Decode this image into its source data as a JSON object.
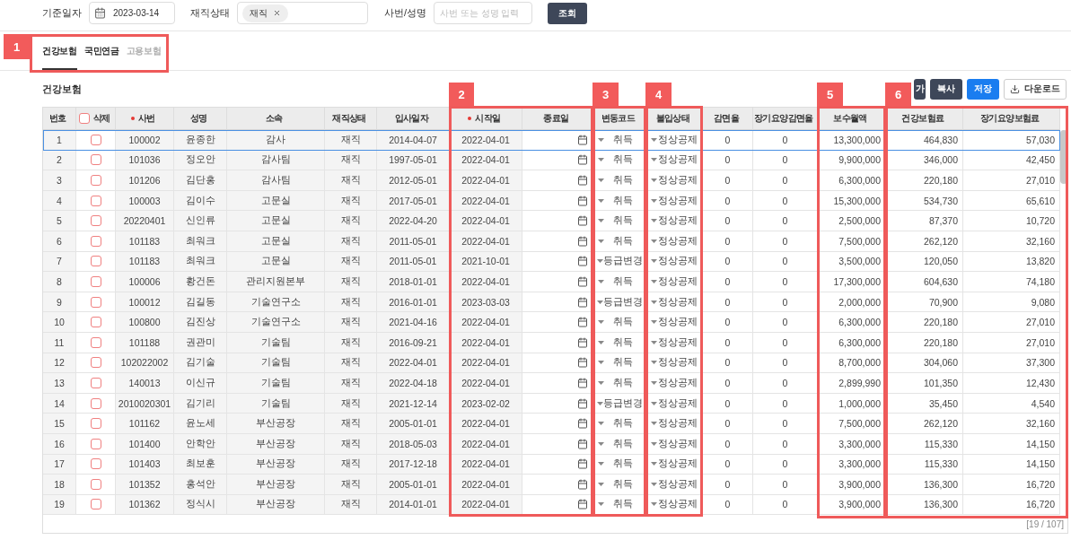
{
  "filters": {
    "date_label": "기준일자",
    "date_value": "2023-03-14",
    "status_label": "재직상태",
    "status_chips": [
      "재직"
    ],
    "search_label": "사번/성명",
    "search_placeholder": "사번 또는 성명 입력",
    "search_button": "조회"
  },
  "tabs": [
    {
      "label": "건강보험",
      "selected": true,
      "disabled": false
    },
    {
      "label": "국민연금",
      "selected": false,
      "disabled": false
    },
    {
      "label": "고용보험",
      "selected": false,
      "disabled": true
    }
  ],
  "section_title": "건강보험",
  "actions": [
    {
      "label": "가",
      "kind": "dark"
    },
    {
      "label": "복사",
      "kind": "dark"
    },
    {
      "label": "저장",
      "kind": "primary"
    },
    {
      "label": "다운로드",
      "kind": "download"
    }
  ],
  "table": {
    "columns": [
      {
        "label": "번호",
        "kind": "readonly",
        "required": false
      },
      {
        "label": "삭제",
        "kind": "check",
        "required": false,
        "checked": false
      },
      {
        "label": "사번",
        "kind": "readonly",
        "required": true
      },
      {
        "label": "성명",
        "kind": "readonly",
        "required": false
      },
      {
        "label": "소속",
        "kind": "readonly",
        "required": false
      },
      {
        "label": "재직상태",
        "kind": "readonly",
        "required": false
      },
      {
        "label": "입사일자",
        "kind": "readonly",
        "required": false
      },
      {
        "label": "시작일",
        "kind": "readonly",
        "required": true
      },
      {
        "label": "종료일",
        "kind": "picker",
        "required": false
      },
      {
        "label": "변동코드",
        "kind": "select",
        "required": false
      },
      {
        "label": "불입상태",
        "kind": "select",
        "required": false
      },
      {
        "label": "감면율",
        "kind": "input",
        "required": false
      },
      {
        "label": "장기요양감면율",
        "kind": "input",
        "required": false
      },
      {
        "label": "보수월액",
        "kind": "amount",
        "required": false
      },
      {
        "label": "건강보험료",
        "kind": "amount",
        "required": false
      },
      {
        "label": "장기요양보험료",
        "kind": "amount",
        "required": false
      }
    ],
    "rows": [
      {
        "selected": true,
        "checked": false,
        "cells": [
          "1",
          "",
          "100002",
          "윤종한",
          "감사",
          "재직",
          "2014-04-07",
          "2022-04-01",
          "",
          "취득",
          "정상공제",
          "0",
          "0",
          "13,300,000",
          "464,830",
          "57,030"
        ]
      },
      {
        "selected": false,
        "checked": false,
        "cells": [
          "2",
          "",
          "101036",
          "정오안",
          "감사팀",
          "재직",
          "1997-05-01",
          "2022-04-01",
          "",
          "취득",
          "정상공제",
          "0",
          "0",
          "9,900,000",
          "346,000",
          "42,450"
        ]
      },
      {
        "selected": false,
        "checked": false,
        "cells": [
          "3",
          "",
          "101206",
          "김단홍",
          "감사팀",
          "재직",
          "2012-05-01",
          "2022-04-01",
          "",
          "취득",
          "정상공제",
          "0",
          "0",
          "6,300,000",
          "220,180",
          "27,010"
        ]
      },
      {
        "selected": false,
        "checked": false,
        "cells": [
          "4",
          "",
          "100003",
          "김이수",
          "고문실",
          "재직",
          "2017-05-01",
          "2022-04-01",
          "",
          "취득",
          "정상공제",
          "0",
          "0",
          "15,300,000",
          "534,730",
          "65,610"
        ]
      },
      {
        "selected": false,
        "checked": false,
        "cells": [
          "5",
          "",
          "20220401",
          "신인류",
          "고문실",
          "재직",
          "2022-04-20",
          "2022-04-01",
          "",
          "취득",
          "정상공제",
          "0",
          "0",
          "2,500,000",
          "87,370",
          "10,720"
        ]
      },
      {
        "selected": false,
        "checked": false,
        "cells": [
          "6",
          "",
          "101183",
          "최워크",
          "고문실",
          "재직",
          "2011-05-01",
          "2022-04-01",
          "",
          "취득",
          "정상공제",
          "0",
          "0",
          "7,500,000",
          "262,120",
          "32,160"
        ]
      },
      {
        "selected": false,
        "checked": false,
        "cells": [
          "7",
          "",
          "101183",
          "최워크",
          "고문실",
          "재직",
          "2011-05-01",
          "2021-10-01",
          "",
          "등급변경",
          "정상공제",
          "0",
          "0",
          "3,500,000",
          "120,050",
          "13,820"
        ]
      },
      {
        "selected": false,
        "checked": false,
        "cells": [
          "8",
          "",
          "100006",
          "황건돈",
          "관리지원본부",
          "재직",
          "2018-01-01",
          "2022-04-01",
          "",
          "취득",
          "정상공제",
          "0",
          "0",
          "17,300,000",
          "604,630",
          "74,180"
        ]
      },
      {
        "selected": false,
        "checked": false,
        "cells": [
          "9",
          "",
          "100012",
          "김길동",
          "기술연구소",
          "재직",
          "2016-01-01",
          "2023-03-03",
          "",
          "등급변경",
          "정상공제",
          "0",
          "0",
          "2,000,000",
          "70,900",
          "9,080"
        ]
      },
      {
        "selected": false,
        "checked": false,
        "cells": [
          "10",
          "",
          "100800",
          "김진상",
          "기술연구소",
          "재직",
          "2021-04-16",
          "2022-04-01",
          "",
          "취득",
          "정상공제",
          "0",
          "0",
          "6,300,000",
          "220,180",
          "27,010"
        ]
      },
      {
        "selected": false,
        "checked": false,
        "cells": [
          "11",
          "",
          "101188",
          "권관미",
          "기술팀",
          "재직",
          "2016-09-21",
          "2022-04-01",
          "",
          "취득",
          "정상공제",
          "0",
          "0",
          "6,300,000",
          "220,180",
          "27,010"
        ]
      },
      {
        "selected": false,
        "checked": false,
        "cells": [
          "12",
          "",
          "102022002",
          "김기술",
          "기술팀",
          "재직",
          "2022-04-01",
          "2022-04-01",
          "",
          "취득",
          "정상공제",
          "0",
          "0",
          "8,700,000",
          "304,060",
          "37,300"
        ]
      },
      {
        "selected": false,
        "checked": false,
        "cells": [
          "13",
          "",
          "140013",
          "이신규",
          "기술팀",
          "재직",
          "2022-04-18",
          "2022-04-01",
          "",
          "취득",
          "정상공제",
          "0",
          "0",
          "2,899,990",
          "101,350",
          "12,430"
        ]
      },
      {
        "selected": false,
        "checked": false,
        "cells": [
          "14",
          "",
          "2010020301",
          "김기리",
          "기술팀",
          "재직",
          "2021-12-14",
          "2023-02-02",
          "",
          "등급변경",
          "정상공제",
          "0",
          "0",
          "1,000,000",
          "35,450",
          "4,540"
        ]
      },
      {
        "selected": false,
        "checked": false,
        "cells": [
          "15",
          "",
          "101162",
          "윤노세",
          "부산공장",
          "재직",
          "2005-01-01",
          "2022-04-01",
          "",
          "취득",
          "정상공제",
          "0",
          "0",
          "7,500,000",
          "262,120",
          "32,160"
        ]
      },
      {
        "selected": false,
        "checked": false,
        "cells": [
          "16",
          "",
          "101400",
          "안학안",
          "부산공장",
          "재직",
          "2018-05-03",
          "2022-04-01",
          "",
          "취득",
          "정상공제",
          "0",
          "0",
          "3,300,000",
          "115,330",
          "14,150"
        ]
      },
      {
        "selected": false,
        "checked": false,
        "cells": [
          "17",
          "",
          "101403",
          "최보훈",
          "부산공장",
          "재직",
          "2017-12-18",
          "2022-04-01",
          "",
          "취득",
          "정상공제",
          "0",
          "0",
          "3,300,000",
          "115,330",
          "14,150"
        ]
      },
      {
        "selected": false,
        "checked": false,
        "cells": [
          "18",
          "",
          "101352",
          "홍석안",
          "부산공장",
          "재직",
          "2005-01-01",
          "2022-04-01",
          "",
          "취득",
          "정상공제",
          "0",
          "0",
          "3,900,000",
          "136,300",
          "16,720"
        ]
      },
      {
        "selected": false,
        "checked": false,
        "cells": [
          "19",
          "",
          "101362",
          "정식시",
          "부산공장",
          "재직",
          "2014-01-01",
          "2022-04-01",
          "",
          "취득",
          "정상공제",
          "0",
          "0",
          "3,900,000",
          "136,300",
          "16,720"
        ]
      }
    ],
    "count": "[19 / 107]"
  },
  "annotations": [
    {
      "label": "1"
    },
    {
      "label": "2"
    },
    {
      "label": "3"
    },
    {
      "label": "4"
    },
    {
      "label": "5"
    },
    {
      "label": "6"
    }
  ]
}
